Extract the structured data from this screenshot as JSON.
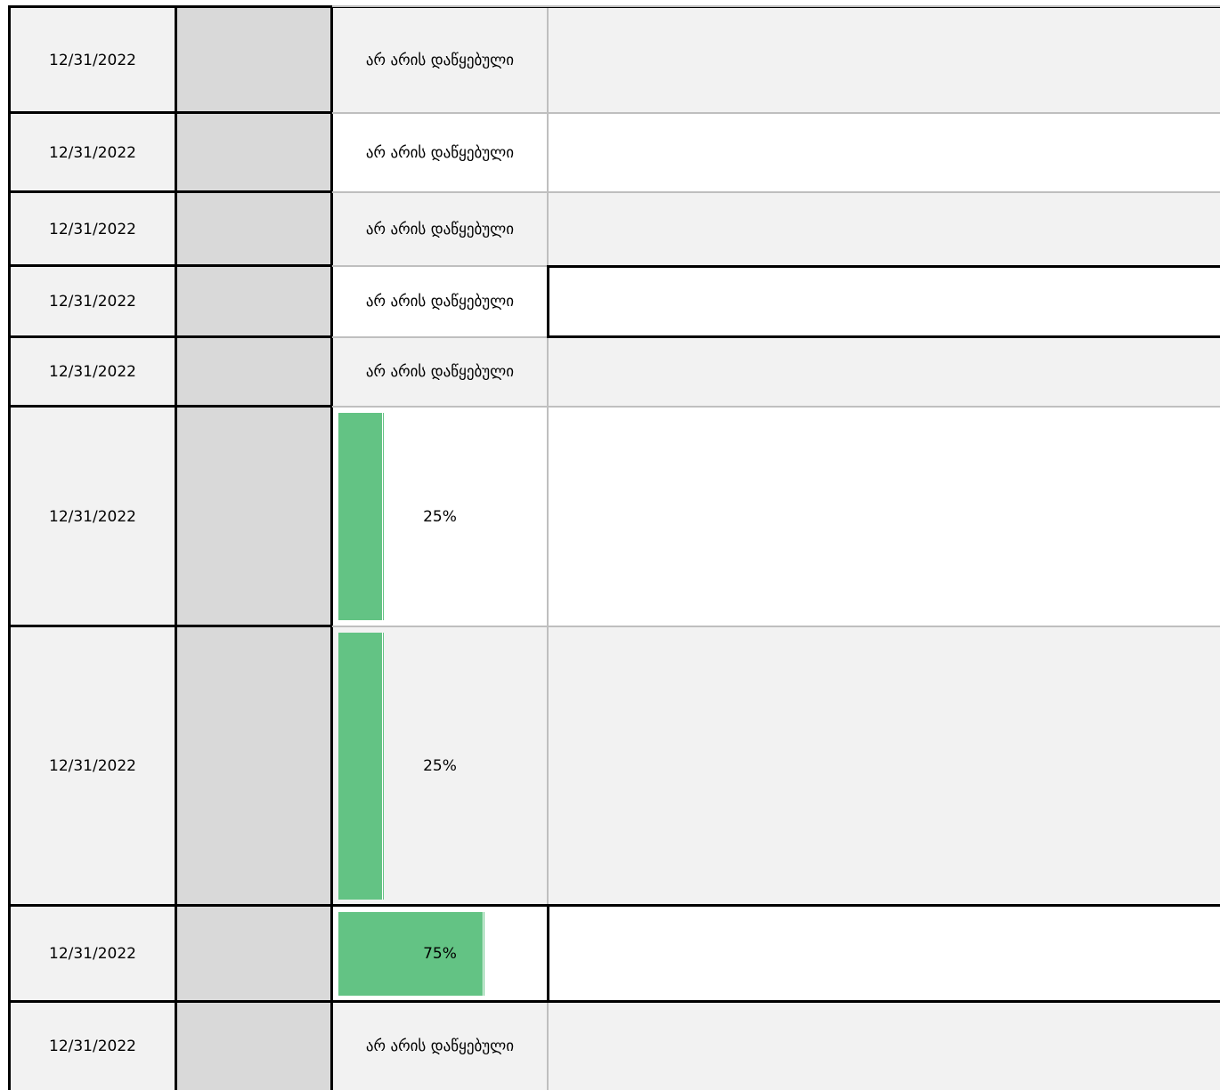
{
  "colors": {
    "date_bg": "#f2f2f2",
    "gray_column": "#d9d9d9",
    "progress_bar": "#63c384",
    "border_dark": "#000000",
    "border_light": "#bfbfbf"
  },
  "rows": [
    {
      "date": "12/31/2022",
      "status": "არ არის დაწყებული",
      "progress": null
    },
    {
      "date": "12/31/2022",
      "status": "არ არის დაწყებული",
      "progress": null
    },
    {
      "date": "12/31/2022",
      "status": "არ არის დაწყებული",
      "progress": null
    },
    {
      "date": "12/31/2022",
      "status": "არ არის დაწყებული",
      "progress": null
    },
    {
      "date": "12/31/2022",
      "status": "არ არის დაწყებული",
      "progress": null
    },
    {
      "date": "12/31/2022",
      "status": "25%",
      "progress": 0.25
    },
    {
      "date": "12/31/2022",
      "status": "25%",
      "progress": 0.25
    },
    {
      "date": "12/31/2022",
      "status": "75%",
      "progress": 0.75
    },
    {
      "date": "12/31/2022",
      "status": "არ არის დაწყებული",
      "progress": null
    }
  ]
}
